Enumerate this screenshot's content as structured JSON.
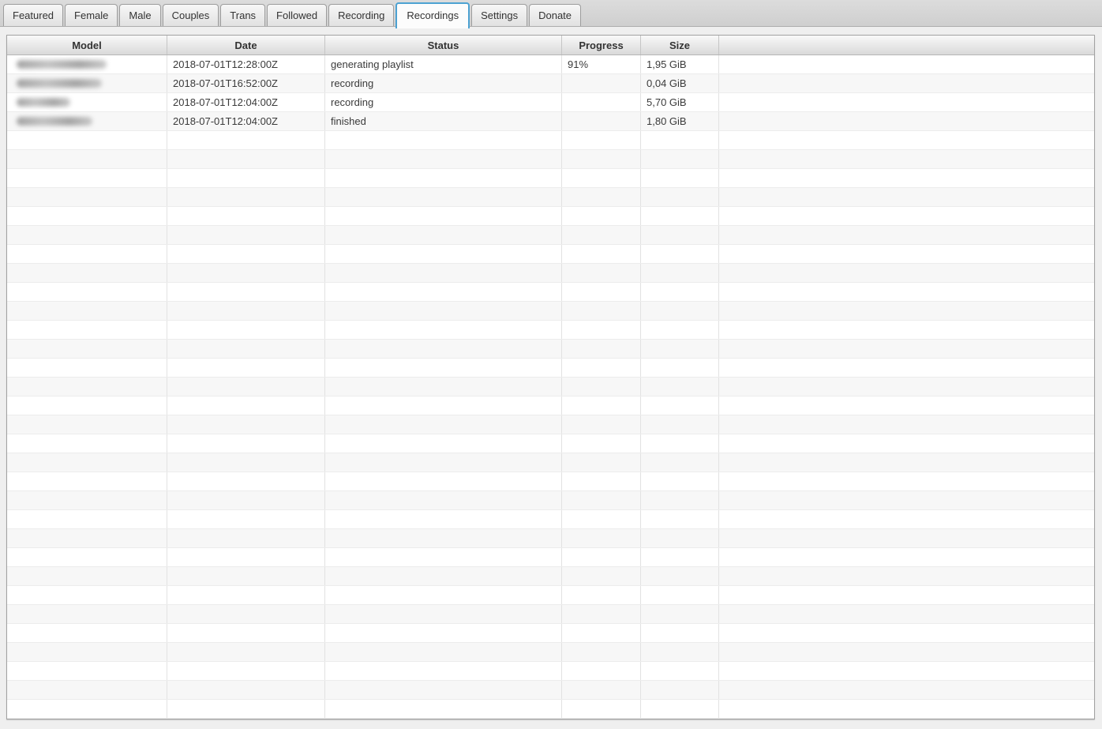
{
  "tabs": {
    "items": [
      {
        "label": "Featured",
        "active": false
      },
      {
        "label": "Female",
        "active": false
      },
      {
        "label": "Male",
        "active": false
      },
      {
        "label": "Couples",
        "active": false
      },
      {
        "label": "Trans",
        "active": false
      },
      {
        "label": "Followed",
        "active": false
      },
      {
        "label": "Recording",
        "active": false
      },
      {
        "label": "Recordings",
        "active": true
      },
      {
        "label": "Settings",
        "active": false
      },
      {
        "label": "Donate",
        "active": false
      }
    ]
  },
  "table": {
    "columns": [
      {
        "key": "model",
        "label": "Model"
      },
      {
        "key": "date",
        "label": "Date"
      },
      {
        "key": "status",
        "label": "Status"
      },
      {
        "key": "progress",
        "label": "Progress"
      },
      {
        "key": "size",
        "label": "Size"
      },
      {
        "key": "extra",
        "label": ""
      }
    ],
    "rows": [
      {
        "model_redacted": true,
        "model_blur_width": 114,
        "date": "2018-07-01T12:28:00Z",
        "status": "generating playlist",
        "progress": "91%",
        "size": "1,95 GiB",
        "extra": ""
      },
      {
        "model_redacted": true,
        "model_blur_width": 108,
        "date": "2018-07-01T16:52:00Z",
        "status": "recording",
        "progress": "",
        "size": "0,04 GiB",
        "extra": ""
      },
      {
        "model_redacted": true,
        "model_blur_width": 68,
        "date": "2018-07-01T12:04:00Z",
        "status": "recording",
        "progress": "",
        "size": "5,70 GiB",
        "extra": ""
      },
      {
        "model_redacted": true,
        "model_blur_width": 96,
        "date": "2018-07-01T12:04:00Z",
        "status": "finished",
        "progress": "",
        "size": "1,80 GiB",
        "extra": ""
      }
    ],
    "empty_row_count": 31
  },
  "colors": {
    "active_tab_border": "#4da2d2",
    "row_stripe": "#f7f7f7",
    "grid_line": "#e2e2e2",
    "header_text": "#333333",
    "cell_text": "#3a3a3a",
    "window_background": "#efefef",
    "tab_strip_background": "#d4d4d4"
  }
}
